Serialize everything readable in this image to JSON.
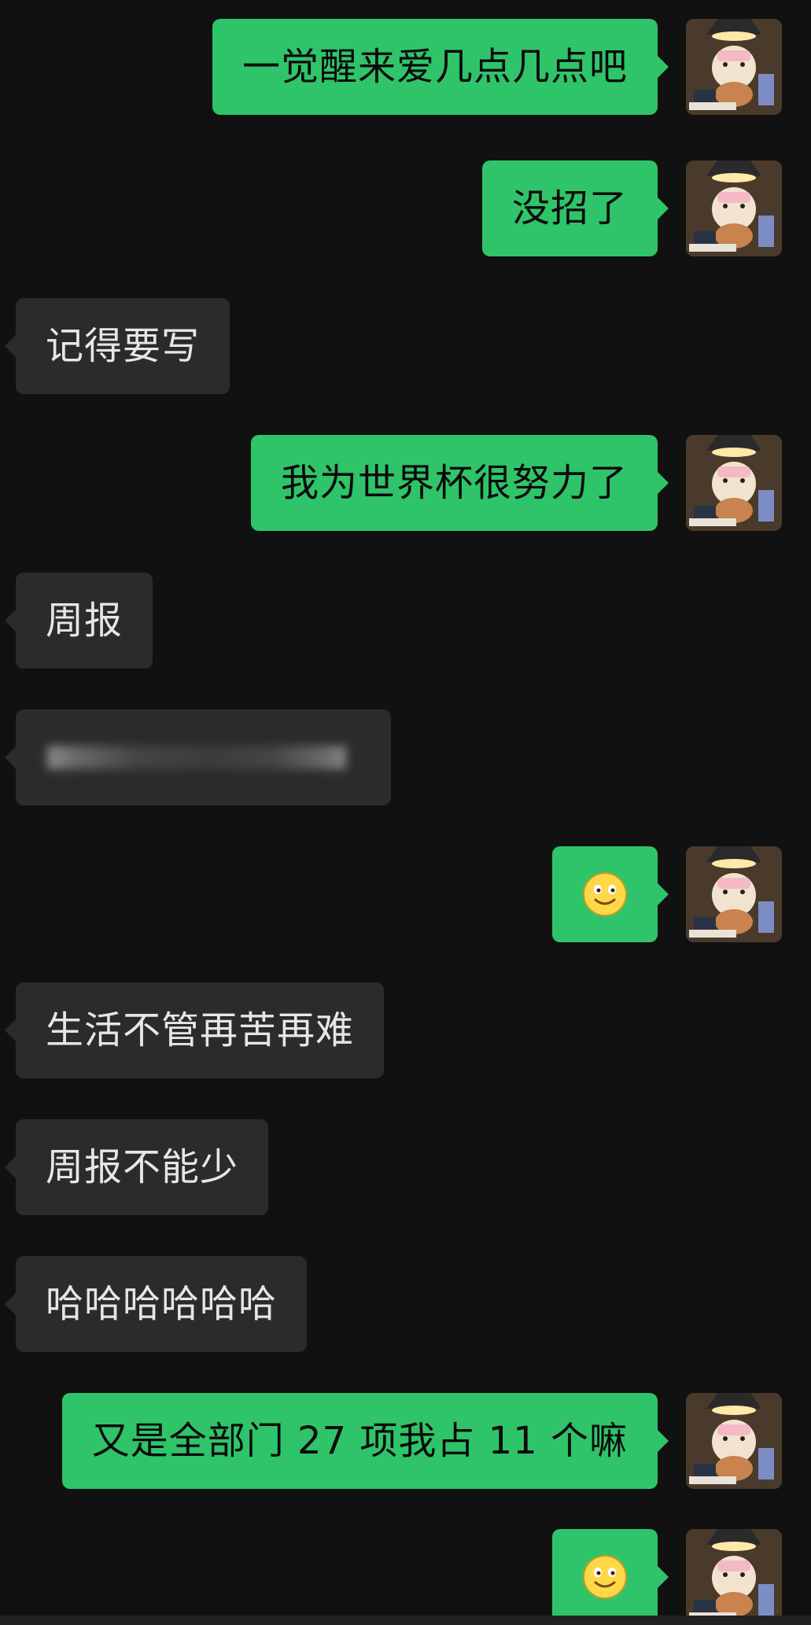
{
  "chat": {
    "messages": [
      {
        "side": "out",
        "text": "一觉醒来爱几点几点吧"
      },
      {
        "side": "out",
        "text": "没招了"
      },
      {
        "side": "in",
        "text": "记得要写"
      },
      {
        "side": "out",
        "text": "我为世界杯很努力了"
      },
      {
        "side": "in",
        "text": "周报"
      },
      {
        "side": "in",
        "text": "",
        "note": "blurred"
      },
      {
        "side": "out",
        "emoji": "smile-emoji"
      },
      {
        "side": "in",
        "text": "生活不管再苦再难"
      },
      {
        "side": "in",
        "text": "周报不能少"
      },
      {
        "side": "in",
        "text": "哈哈哈哈哈哈"
      },
      {
        "side": "out",
        "text": "又是全部门 27 项我占 11 个嘛"
      },
      {
        "side": "out",
        "emoji": "smile-emoji"
      }
    ]
  },
  "colors": {
    "background": "#111111",
    "outgoing_bubble": "#2fc46a",
    "incoming_bubble": "#2b2b2b",
    "incoming_text": "#e6e6e6"
  }
}
